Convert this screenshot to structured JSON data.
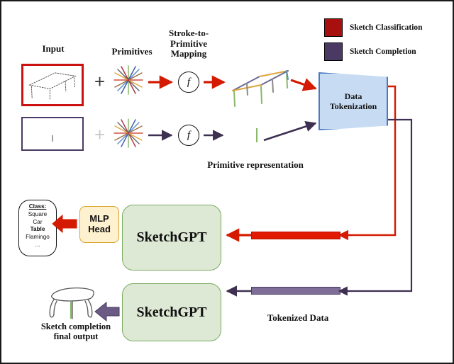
{
  "figure": {
    "title": "SketchGPT pipeline diagram",
    "border_color": "#1a1a1a",
    "background": "#ffffff"
  },
  "legend": {
    "items": [
      {
        "label": "Sketch Classification",
        "color": "#a80f0f",
        "swatch_name": "red-swatch"
      },
      {
        "label": "Sketch Completion",
        "color": "#4a3a63",
        "swatch_name": "purple-swatch"
      }
    ]
  },
  "labels": {
    "input": "Input",
    "primitives": "Primitives",
    "stroke_mapping": "Stroke-to-\nPrimitive\nMapping",
    "primitive_representation": "Primitive representation",
    "tokenized_data": "Tokenized Data",
    "output_caption": "Sketch completion\nfinal output"
  },
  "nodes": {
    "function_top": "f",
    "function_bottom": "f",
    "plus_top": "+",
    "plus_bottom": "+",
    "tokenization": "Data\nTokenization",
    "sketchgpt_classify": "SketchGPT",
    "sketchgpt_complete": "SketchGPT",
    "mlp_head": "MLP\nHead"
  },
  "class_list": {
    "heading": "Class:",
    "items": [
      "Square",
      "Car",
      "Table",
      "Flamingo",
      "..."
    ],
    "highlighted": "Table"
  },
  "colors": {
    "classification_red": "#e01b00",
    "completion_purple": "#7e6d96",
    "completion_purple_dark": "#4a3a63",
    "tokenization_fill": "#c7dcf2",
    "tokenization_border": "#4a79c0",
    "gpt_fill": "#dde9d4",
    "gpt_border": "#7aab63",
    "mlp_fill": "#fdf1cf",
    "mlp_border": "#d9a52c",
    "input_box_red": "#cc1111"
  }
}
